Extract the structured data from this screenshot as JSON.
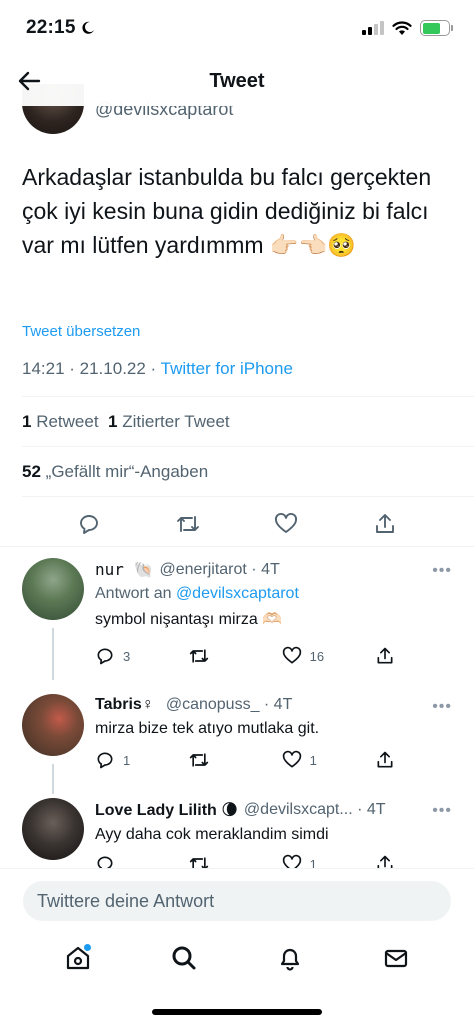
{
  "status_bar": {
    "time": "22:15",
    "battery_color": "#34c759"
  },
  "header": {
    "title": "Tweet",
    "back_icon": "arrow-left-icon"
  },
  "tweet": {
    "handle": "@devilsxcaptarot",
    "text": "Arkadaşlar istanbulda bu falcı gerçekten çok iyi kesin buna gidin dediğiniz bi falcı var mı lütfen yardımmm 👉🏻👈🏻🥺",
    "translate_label": "Tweet übersetzen",
    "time": "14:21 · 21.10.22 · ",
    "source": "Twitter for iPhone",
    "retweets_count": "1",
    "retweets_label": "Retweet",
    "quotes_count": "1",
    "quotes_label": "Zitierter Tweet",
    "likes_count": "52",
    "likes_label": "„Gefällt mir“-Angaben"
  },
  "replies": [
    {
      "name": "nur 🐚",
      "handle": "@enerjitarot · 4T",
      "reply_to_prefix": "Antwort an ",
      "reply_to_mention": "@devilsxcaptarot",
      "text": "symbol nişantaşı mirza 🫶🏻",
      "comments": "3",
      "retweets": "",
      "likes": "16"
    },
    {
      "name": "Tabris♀",
      "handle": "@canopuss_ · 4T",
      "text": "mirza bize tek atıyo mutlaka git.",
      "comments": "1",
      "retweets": "",
      "likes": "1"
    },
    {
      "name": "Love Lady Lilith 🌘",
      "handle": "@devilsxcapt... · 4T",
      "text": "Ayy daha cok meraklandim simdi",
      "comments": "",
      "retweets": "",
      "likes": "1"
    }
  ],
  "more_label": "•••",
  "compose": {
    "placeholder": "Twittere deine Antwort"
  },
  "accent_color": "#1d9bf0"
}
